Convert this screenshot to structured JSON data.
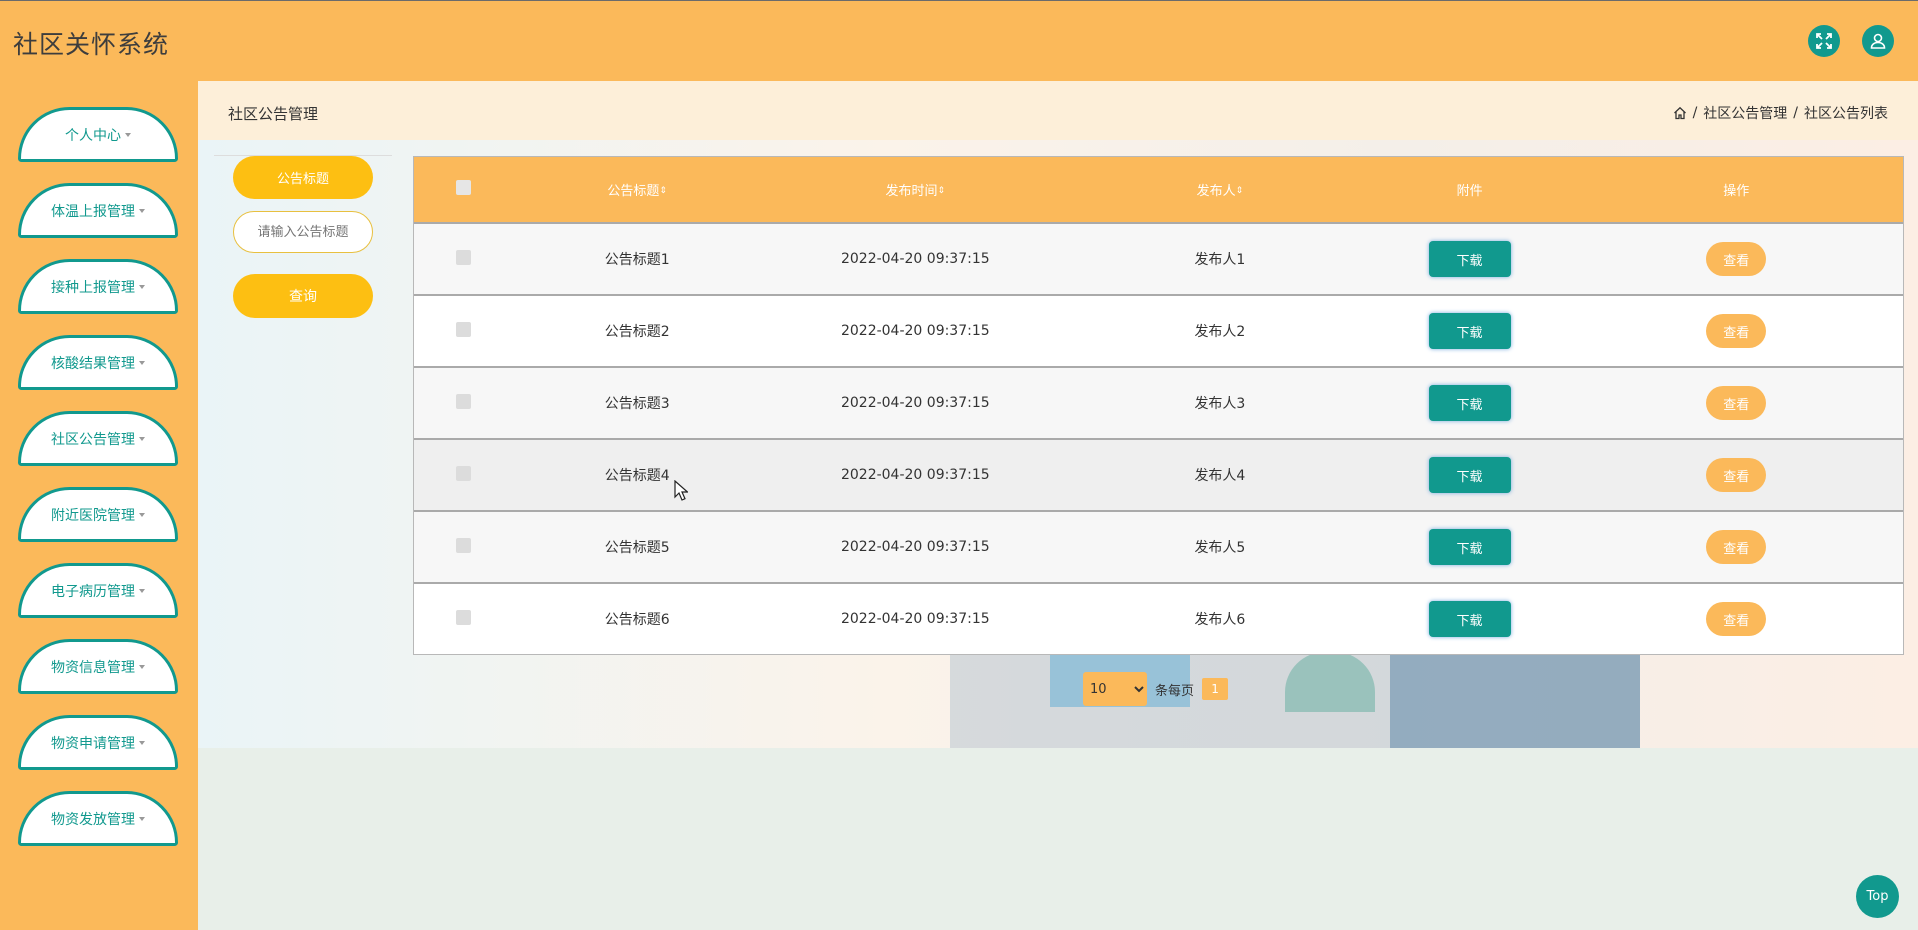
{
  "app": {
    "title": "社区关怀系统"
  },
  "header": {
    "fullscreen_icon": "expand-icon",
    "user_icon": "user-icon"
  },
  "sidebar": {
    "items": [
      {
        "label": "个人中心"
      },
      {
        "label": "体温上报管理"
      },
      {
        "label": "接种上报管理"
      },
      {
        "label": "核酸结果管理"
      },
      {
        "label": "社区公告管理"
      },
      {
        "label": "附近医院管理"
      },
      {
        "label": "电子病历管理"
      },
      {
        "label": "物资信息管理"
      },
      {
        "label": "物资申请管理"
      },
      {
        "label": "物资发放管理"
      }
    ]
  },
  "page": {
    "title": "社区公告管理",
    "breadcrumb": [
      "社区公告管理",
      "社区公告列表"
    ],
    "separator": "/"
  },
  "search": {
    "label": "公告标题",
    "placeholder": "请输入公告标题",
    "button": "查询"
  },
  "table": {
    "columns": [
      "公告标题",
      "发布时间",
      "发布人",
      "附件",
      "操作"
    ],
    "download_label": "下载",
    "view_label": "查看",
    "rows": [
      {
        "title": "公告标题1",
        "time": "2022-04-20 09:37:15",
        "publisher": "发布人1"
      },
      {
        "title": "公告标题2",
        "time": "2022-04-20 09:37:15",
        "publisher": "发布人2"
      },
      {
        "title": "公告标题3",
        "time": "2022-04-20 09:37:15",
        "publisher": "发布人3"
      },
      {
        "title": "公告标题4",
        "time": "2022-04-20 09:37:15",
        "publisher": "发布人4"
      },
      {
        "title": "公告标题5",
        "time": "2022-04-20 09:37:15",
        "publisher": "发布人5"
      },
      {
        "title": "公告标题6",
        "time": "2022-04-20 09:37:15",
        "publisher": "发布人6"
      }
    ]
  },
  "pagination": {
    "page_size": "10",
    "per_page_label": "条每页",
    "current_page": "1"
  },
  "top_button": "Top",
  "colors": {
    "primary": "#fbb95a",
    "accent": "#11998e",
    "yellow": "#fdbf12"
  }
}
